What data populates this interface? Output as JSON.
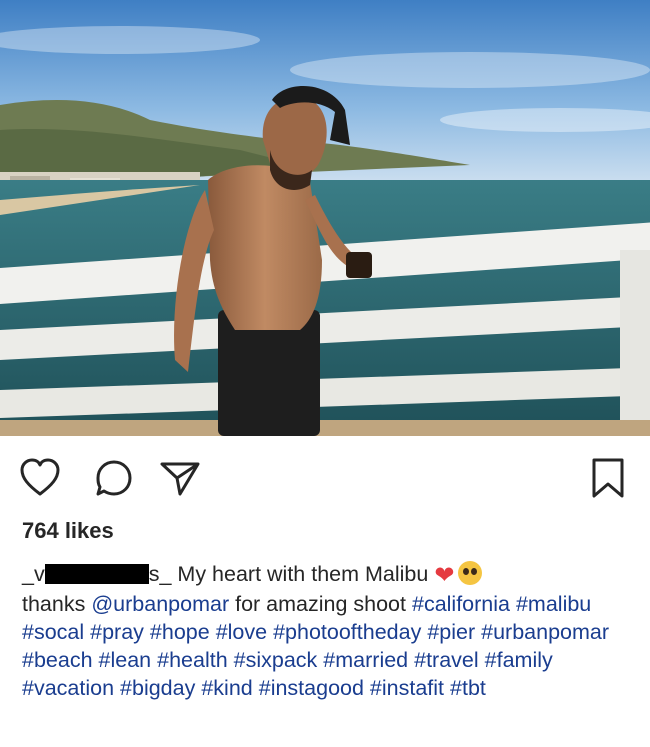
{
  "post": {
    "likes_text": "764 likes",
    "username_prefix": "_v",
    "username_suffix": "s_",
    "caption_text": "My heart with them Malibu",
    "line2_prefix": "thanks",
    "mention": "@urbanpomar",
    "line2_middle": "for amazing shoot",
    "hashtags": [
      "#california",
      "#malibu",
      "#socal",
      "#pray",
      "#hope",
      "#love",
      "#photooftheday",
      "#pier",
      "#urbanpomar",
      "#beach",
      "#lean",
      "#health",
      "#sixpack",
      "#married",
      "#travel",
      "#family",
      "#vacation",
      "#bigday",
      "#kind",
      "#instagood",
      "#instafit",
      "#tbt"
    ]
  },
  "icons": {
    "like": "heart-outline-icon",
    "comment": "comment-bubble-icon",
    "share": "paper-plane-icon",
    "save": "bookmark-icon"
  },
  "colors": {
    "hashtag": "#1a3d8f",
    "text": "#262626",
    "heart_emoji": "#e53a40"
  }
}
